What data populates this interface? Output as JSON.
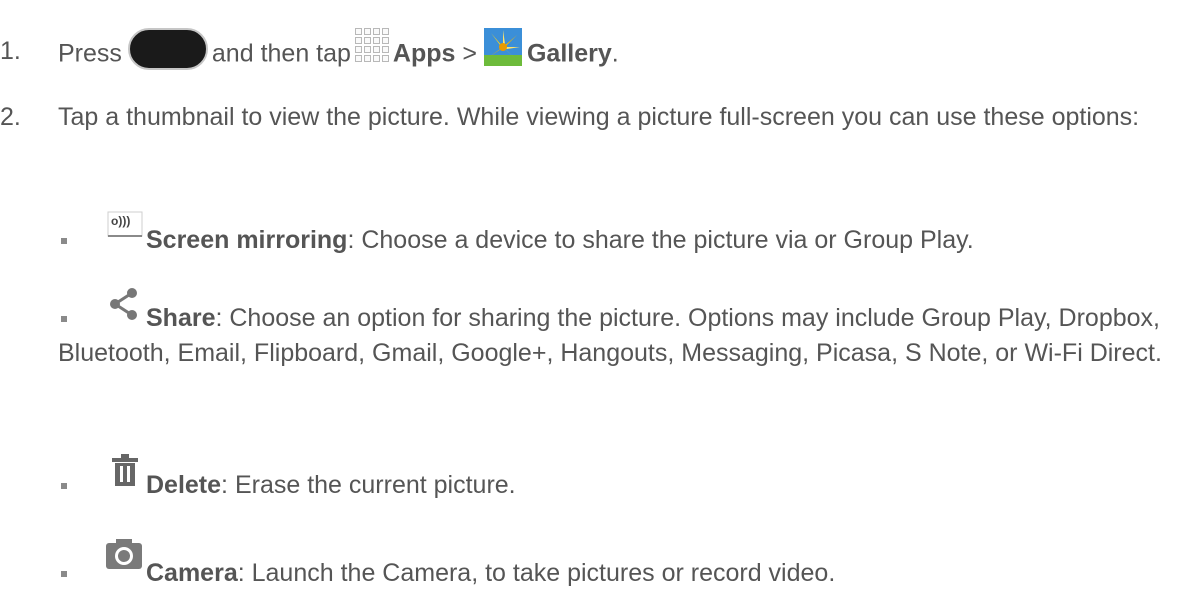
{
  "step1": {
    "number": "1.",
    "press": "Press",
    "and_then_tap": "and then tap",
    "apps": "Apps",
    "separator": ">",
    "gallery": "Gallery",
    "end": "."
  },
  "step2": {
    "number": "2.",
    "text": "Tap a thumbnail to view the picture. While viewing a picture full-screen you can use these options:"
  },
  "options": [
    {
      "icon": "screen-mirroring-icon",
      "label": "Screen mirroring",
      "desc": ": Choose a device to share the picture via or Group Play."
    },
    {
      "icon": "share-icon",
      "label": "Share",
      "desc": ": Choose an option for sharing the picture. Options may include Group Play, Dropbox, Bluetooth, Email, Flipboard, Gmail, Google+, Hangouts, Messaging, Picasa, S Note, or Wi-Fi Direct."
    },
    {
      "icon": "trash-icon",
      "label": "Delete",
      "desc": ": Erase the current picture."
    },
    {
      "icon": "camera-icon",
      "label": "Camera",
      "desc": ": Launch the Camera, to take pictures or record video."
    }
  ],
  "colors": {
    "text": "#555555",
    "bullet": "#8a8a8a",
    "home_key": "#1a1a1a"
  }
}
